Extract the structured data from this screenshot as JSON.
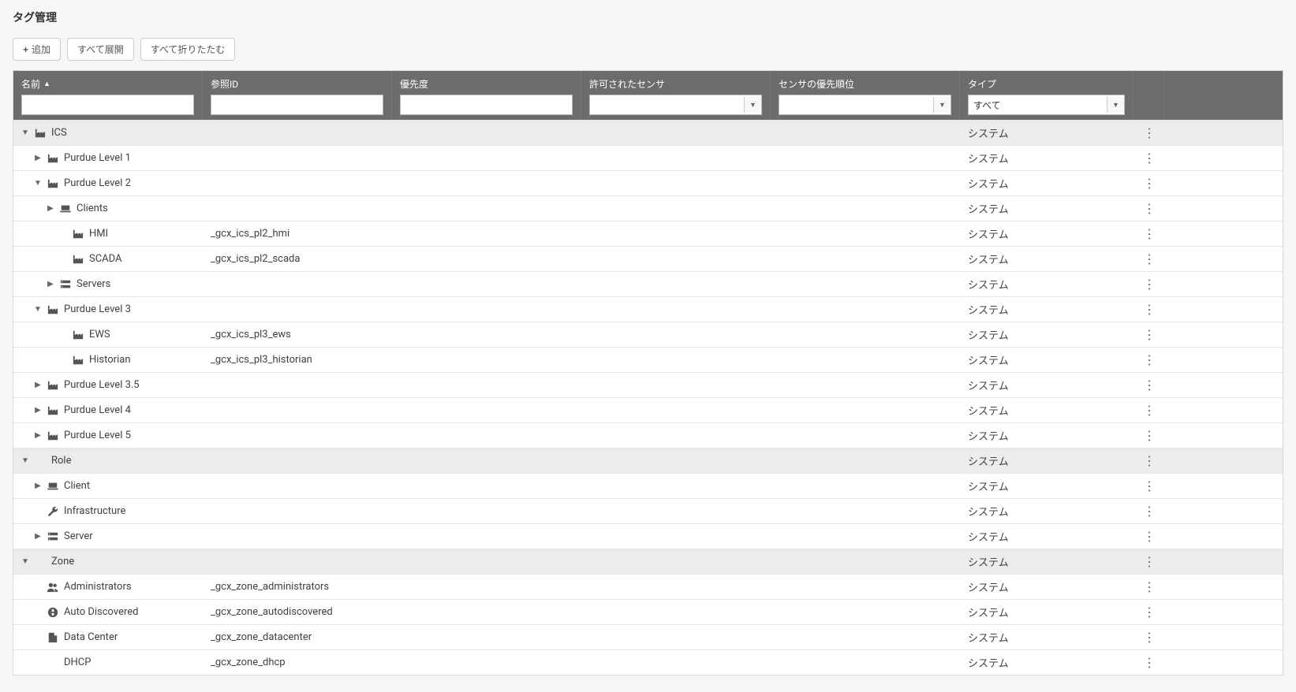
{
  "title": "タグ管理",
  "toolbar": {
    "add_label": "追加",
    "expand_all_label": "すべて展開",
    "collapse_all_label": "すべて折りたたむ"
  },
  "columns": {
    "name": "名前",
    "ref_id": "参照ID",
    "priority": "優先度",
    "allowed_sensors": "許可されたセンサ",
    "sensor_priority": "センサの優先順位",
    "type": "タイプ"
  },
  "type_filter_selected": "すべて",
  "type_label_system": "システム",
  "rows": [
    {
      "indent": 0,
      "group": true,
      "expanded": true,
      "hasChildren": true,
      "icon": "factory",
      "name": "ICS",
      "ref": "",
      "type": "システム"
    },
    {
      "indent": 1,
      "group": false,
      "expanded": false,
      "hasChildren": true,
      "icon": "factory",
      "name": "Purdue Level 1",
      "ref": "",
      "type": "システム"
    },
    {
      "indent": 1,
      "group": false,
      "expanded": true,
      "hasChildren": true,
      "icon": "factory",
      "name": "Purdue Level 2",
      "ref": "",
      "type": "システム"
    },
    {
      "indent": 2,
      "group": false,
      "expanded": false,
      "hasChildren": true,
      "icon": "laptop",
      "name": "Clients",
      "ref": "",
      "type": "システム"
    },
    {
      "indent": 3,
      "group": false,
      "expanded": false,
      "hasChildren": false,
      "icon": "factory",
      "name": "HMI",
      "ref": "_gcx_ics_pl2_hmi",
      "type": "システム"
    },
    {
      "indent": 3,
      "group": false,
      "expanded": false,
      "hasChildren": false,
      "icon": "factory",
      "name": "SCADA",
      "ref": "_gcx_ics_pl2_scada",
      "type": "システム"
    },
    {
      "indent": 2,
      "group": false,
      "expanded": false,
      "hasChildren": true,
      "icon": "servers",
      "name": "Servers",
      "ref": "",
      "type": "システム"
    },
    {
      "indent": 1,
      "group": false,
      "expanded": true,
      "hasChildren": true,
      "icon": "factory",
      "name": "Purdue Level 3",
      "ref": "",
      "type": "システム"
    },
    {
      "indent": 3,
      "group": false,
      "expanded": false,
      "hasChildren": false,
      "icon": "factory",
      "name": "EWS",
      "ref": "_gcx_ics_pl3_ews",
      "type": "システム"
    },
    {
      "indent": 3,
      "group": false,
      "expanded": false,
      "hasChildren": false,
      "icon": "factory",
      "name": "Historian",
      "ref": "_gcx_ics_pl3_historian",
      "type": "システム"
    },
    {
      "indent": 1,
      "group": false,
      "expanded": false,
      "hasChildren": true,
      "icon": "factory",
      "name": "Purdue Level 3.5",
      "ref": "",
      "type": "システム"
    },
    {
      "indent": 1,
      "group": false,
      "expanded": false,
      "hasChildren": true,
      "icon": "factory",
      "name": "Purdue Level 4",
      "ref": "",
      "type": "システム"
    },
    {
      "indent": 1,
      "group": false,
      "expanded": false,
      "hasChildren": true,
      "icon": "factory",
      "name": "Purdue Level 5",
      "ref": "",
      "type": "システム"
    },
    {
      "indent": 0,
      "group": true,
      "expanded": true,
      "hasChildren": true,
      "icon": "",
      "name": "Role",
      "ref": "",
      "type": "システム"
    },
    {
      "indent": 1,
      "group": false,
      "expanded": false,
      "hasChildren": true,
      "icon": "laptop",
      "name": "Client",
      "ref": "",
      "type": "システム"
    },
    {
      "indent": 1,
      "group": false,
      "expanded": false,
      "hasChildren": false,
      "icon": "wrench",
      "name": "Infrastructure",
      "ref": "",
      "type": "システム"
    },
    {
      "indent": 1,
      "group": false,
      "expanded": false,
      "hasChildren": true,
      "icon": "servers",
      "name": "Server",
      "ref": "",
      "type": "システム"
    },
    {
      "indent": 0,
      "group": true,
      "expanded": true,
      "hasChildren": true,
      "icon": "",
      "name": "Zone",
      "ref": "",
      "type": "システム"
    },
    {
      "indent": 1,
      "group": false,
      "expanded": false,
      "hasChildren": false,
      "icon": "users",
      "name": "Administrators",
      "ref": "_gcx_zone_administrators",
      "type": "システム"
    },
    {
      "indent": 1,
      "group": false,
      "expanded": false,
      "hasChildren": false,
      "icon": "globe",
      "name": "Auto Discovered",
      "ref": "_gcx_zone_autodiscovered",
      "type": "システム"
    },
    {
      "indent": 1,
      "group": false,
      "expanded": false,
      "hasChildren": false,
      "icon": "building",
      "name": "Data Center",
      "ref": "_gcx_zone_datacenter",
      "type": "システム"
    },
    {
      "indent": 1,
      "group": false,
      "expanded": false,
      "hasChildren": false,
      "icon": "",
      "name": "DHCP",
      "ref": "_gcx_zone_dhcp",
      "type": "システム"
    }
  ]
}
